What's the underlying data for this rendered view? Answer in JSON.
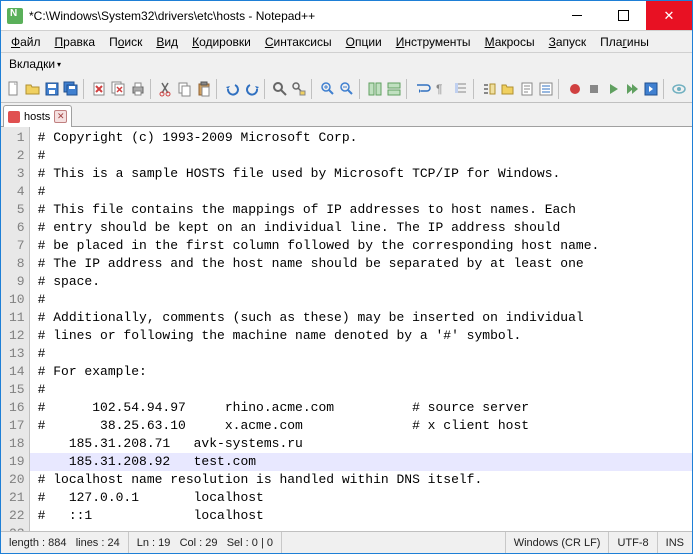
{
  "title": "*C:\\Windows\\System32\\drivers\\etc\\hosts - Notepad++",
  "menubar": {
    "file": "Файл",
    "edit": "Правка",
    "search": "Поиск",
    "view": "Вид",
    "encodings": "Кодировки",
    "syntax": "Синтаксисы",
    "options": "Опции",
    "tools": "Инструменты",
    "macros": "Макросы",
    "run": "Запуск",
    "plugins": "Плагины"
  },
  "submenu": {
    "tabs": "Вкладки"
  },
  "tab": {
    "name": "hosts"
  },
  "code": {
    "lines": [
      "# Copyright (c) 1993-2009 Microsoft Corp.",
      "#",
      "# This is a sample HOSTS file used by Microsoft TCP/IP for Windows.",
      "#",
      "# This file contains the mappings of IP addresses to host names. Each",
      "# entry should be kept on an individual line. The IP address should",
      "# be placed in the first column followed by the corresponding host name.",
      "# The IP address and the host name should be separated by at least one",
      "# space.",
      "#",
      "# Additionally, comments (such as these) may be inserted on individual",
      "# lines or following the machine name denoted by a '#' symbol.",
      "#",
      "# For example:",
      "#",
      "#      102.54.94.97     rhino.acme.com          # source server",
      "#       38.25.63.10     x.acme.com              # x client host",
      "    185.31.208.71   avk-systems.ru",
      "    185.31.208.92   test.com",
      "",
      "# localhost name resolution is handled within DNS itself.",
      "#   127.0.0.1       localhost",
      "#   ::1             localhost",
      ""
    ],
    "highlight_line": 19
  },
  "status": {
    "length_label": "length :",
    "length": "884",
    "lines_label": "lines :",
    "lines": "24",
    "ln_label": "Ln :",
    "ln": "19",
    "col_label": "Col :",
    "col": "29",
    "sel_label": "Sel :",
    "sel": "0 | 0",
    "eol": "Windows (CR LF)",
    "encoding": "UTF-8",
    "mode": "INS"
  }
}
